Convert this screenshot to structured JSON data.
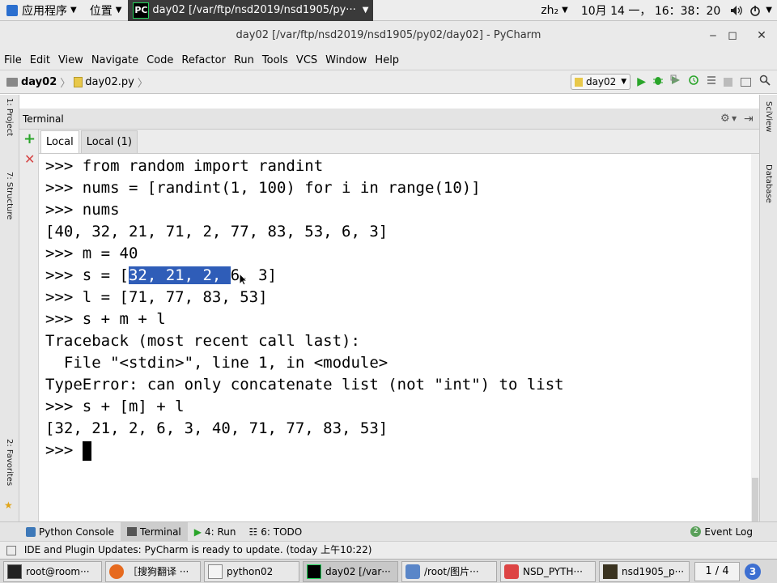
{
  "topbar": {
    "apps_label": "应用程序",
    "places_label": "位置",
    "active_window": "day02 [/var/ftp/nsd2019/nsd1905/py···",
    "input_method": "zh₂",
    "clock": "10月 14 一， 16：38：20"
  },
  "window": {
    "title": "day02 [/var/ftp/nsd2019/nsd1905/py02/day02] - PyCharm"
  },
  "menu": [
    "File",
    "Edit",
    "View",
    "Navigate",
    "Code",
    "Refactor",
    "Run",
    "Tools",
    "VCS",
    "Window",
    "Help"
  ],
  "nav": {
    "breadcrumb_project": "day02",
    "breadcrumb_file": "day02.py",
    "run_config": "day02"
  },
  "terminal": {
    "header_title": "Terminal",
    "tabs": [
      "Local",
      "Local (1)"
    ],
    "lines": [
      ">>> from random import randint",
      ">>> nums = [randint(1, 100) for i in range(10)]",
      ">>> nums",
      "[40, 32, 21, 71, 2, 77, 83, 53, 6, 3]",
      ">>> m = 40",
      "",
      ">>> l = [71, 77, 83, 53]",
      ">>> s + m + l",
      "Traceback (most recent call last):",
      "  File \"<stdin>\", line 1, in <module>",
      "TypeError: can only concatenate list (not \"int\") to list",
      ">>> s + [m] + l",
      "[32, 21, 2, 6, 3, 40, 71, 77, 83, 53]",
      ">>> "
    ],
    "line6_prefix": ">>> s = [",
    "line6_selected": "32, 21, 2, ",
    "line6_suffix": "6, 3]"
  },
  "bottom_tools": {
    "python_console": "Python Console",
    "terminal": "Terminal",
    "run": "4: Run",
    "todo": "6: TODO",
    "event_log": "Event Log",
    "event_count": "2"
  },
  "status": {
    "message": "IDE and Plugin Updates: PyCharm is ready to update. (today 上午10:22)"
  },
  "taskbar": {
    "items": [
      "root@room···",
      "［搜狗翻译 ···",
      "python02",
      "day02 [/var···",
      "/root/图片···",
      "NSD_PYTH···",
      "nsd1905_p···"
    ],
    "workspace": "1 / 4",
    "badge": "3"
  },
  "left_labels": {
    "project": "1: Project",
    "structure": "7: Structure",
    "favorites": "2: Favorites"
  },
  "right_labels": {
    "sciview": "SciView",
    "database": "Database"
  },
  "colors": {
    "selection": "#2f5db8",
    "run_green": "#2aa52a",
    "close_red": "#d64545"
  }
}
